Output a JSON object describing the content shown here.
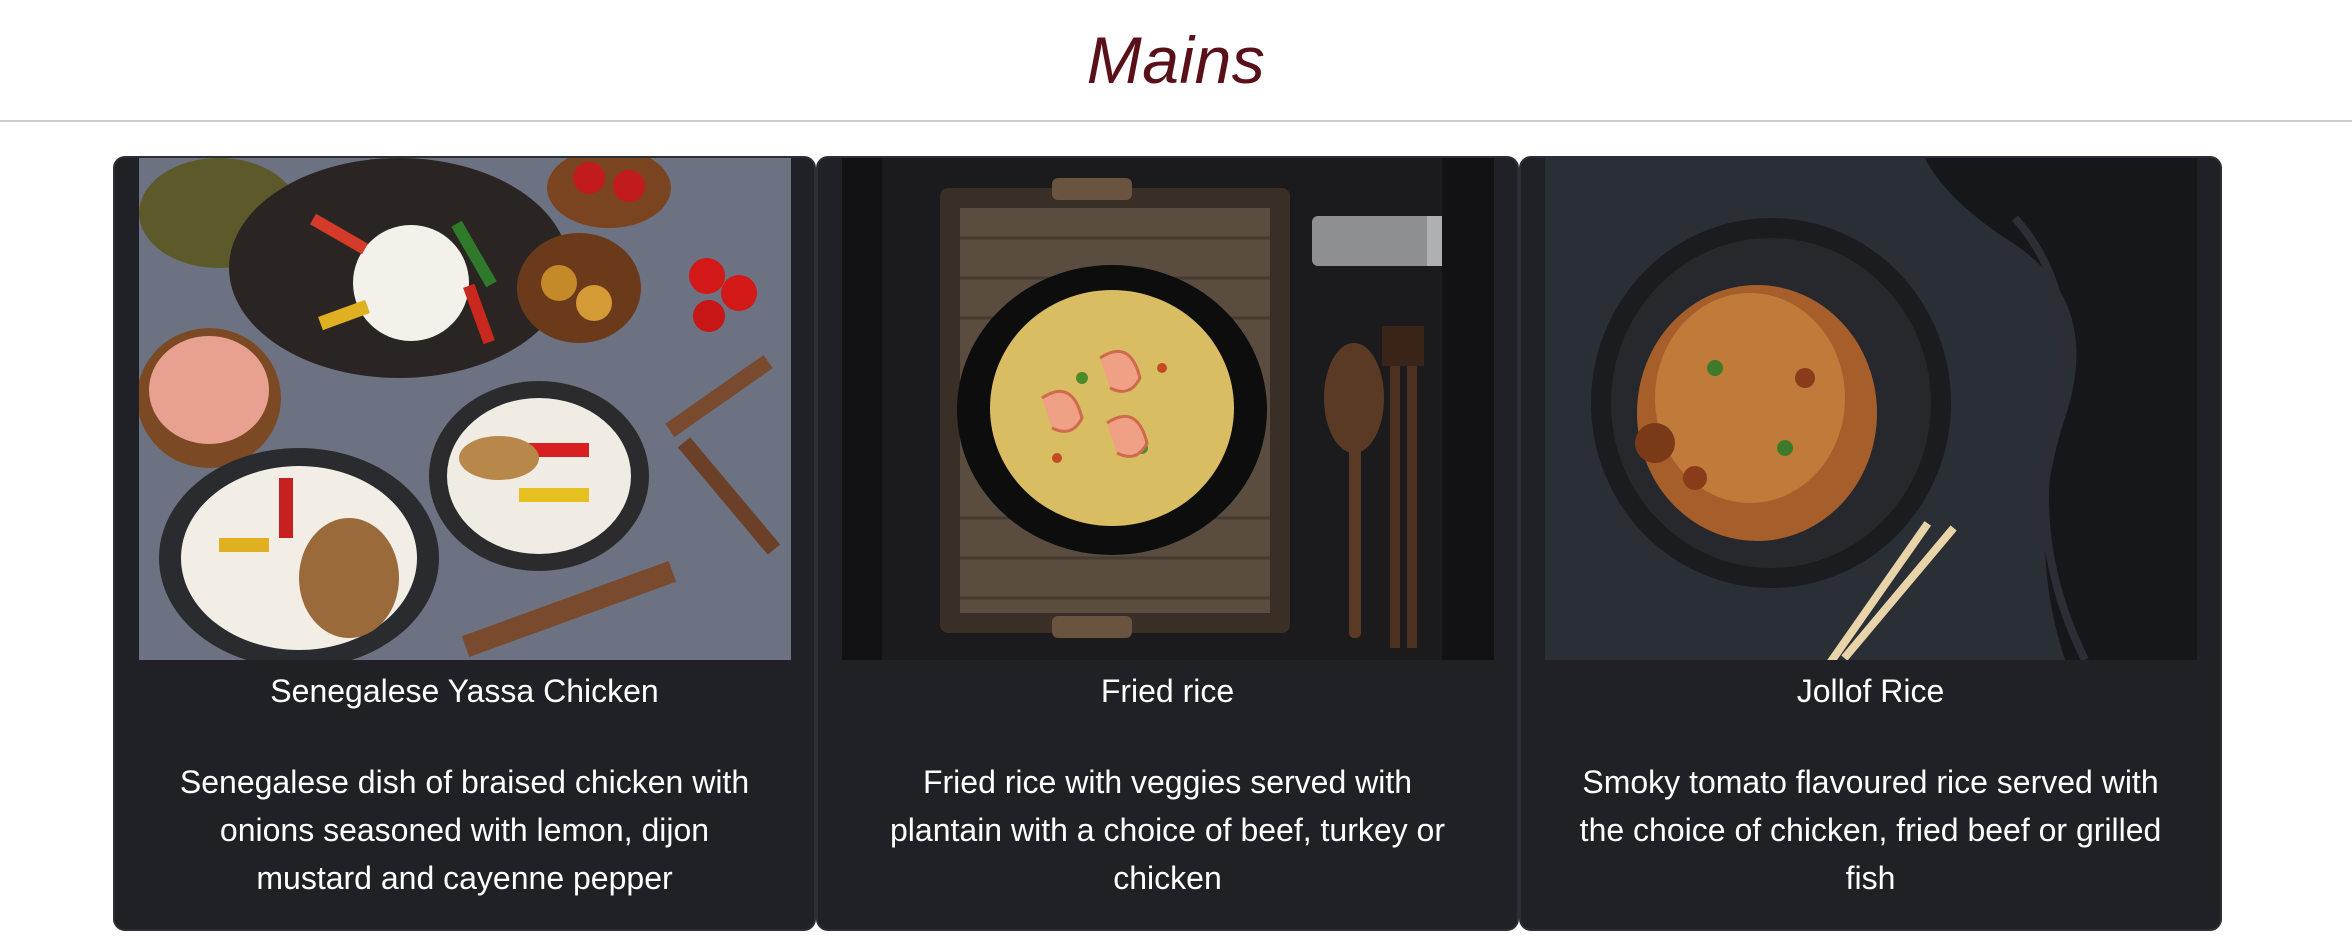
{
  "section": {
    "title": "Mains"
  },
  "dishes": [
    {
      "name": "Senegalese Yassa Chicken",
      "description": "Senegalese dish of braised chicken with onions seasoned with lemon, dijon mustard and cayenne pepper",
      "image_icon": "yassa-chicken-photo"
    },
    {
      "name": "Fried rice",
      "description": "Fried rice with veggies served with plantain with a choice of beef, turkey or chicken",
      "image_icon": "fried-rice-photo"
    },
    {
      "name": "Jollof Rice",
      "description": "Smoky tomato flavoured rice served with the choice of chicken, fried beef or grilled fish",
      "image_icon": "jollof-rice-photo"
    }
  ],
  "colors": {
    "title": "#5a1018",
    "card_bg": "#1f2126",
    "card_text": "#ffffff"
  }
}
